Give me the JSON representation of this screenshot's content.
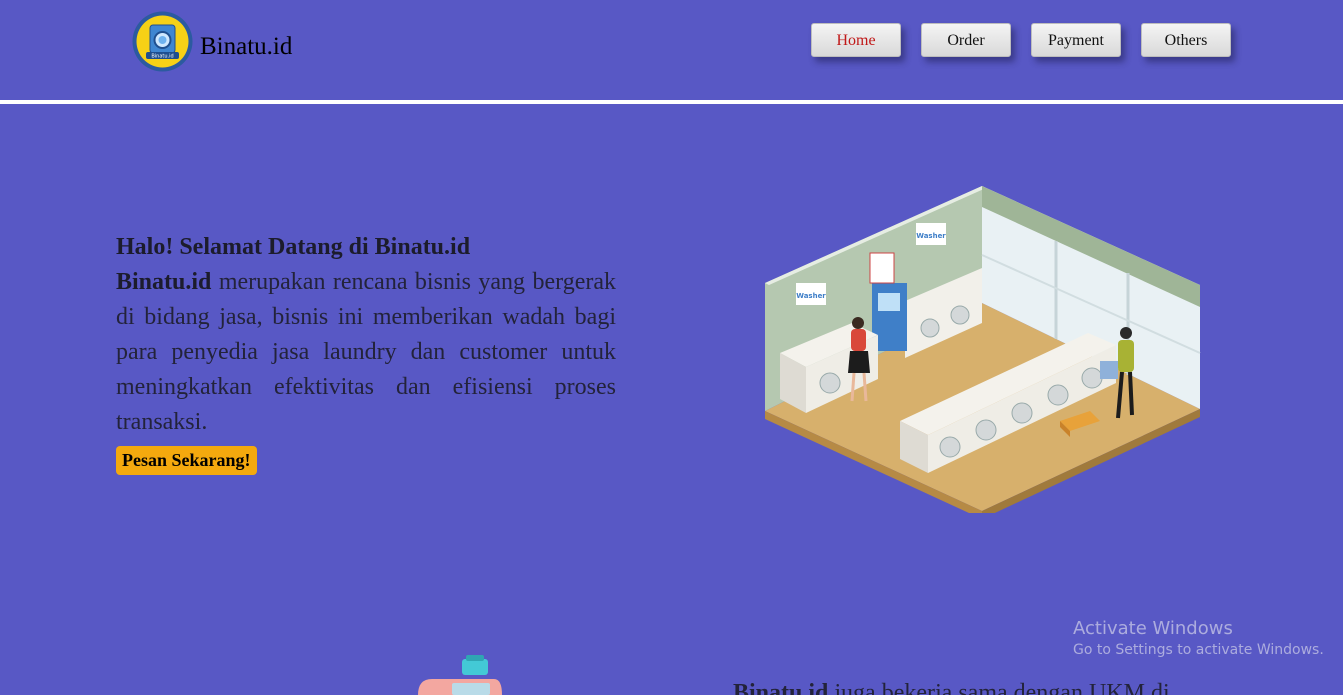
{
  "header": {
    "brand": "Binatu.id",
    "logo_text": "Binatu.id",
    "nav": [
      "Home",
      "Order",
      "Payment",
      "Others"
    ]
  },
  "hero": {
    "title": "Halo! Selamat Datang di Binatu.id",
    "brand_bold": "Binatu.id",
    "paragraph": " merupakan rencana bisnis yang bergerak di bidang jasa, bisnis ini memberikan wadah bagi para penyedia jasa laundry dan customer untuk meningkatkan efektivitas dan efisiensi proses transaksi.",
    "cta": "Pesan Sekarang!",
    "illustration_sign_1": "Washer",
    "illustration_sign_2": "Washer"
  },
  "second_section": {
    "brand_bold": "Binatu.id",
    "text": " juga bekerja sama dengan UKM di"
  },
  "watermark": {
    "title": "Activate Windows",
    "subtitle": "Go to Settings to activate Windows."
  },
  "colors": {
    "background": "#5858c5",
    "cta": "#f4a90e",
    "nav_active": "#c01818"
  }
}
